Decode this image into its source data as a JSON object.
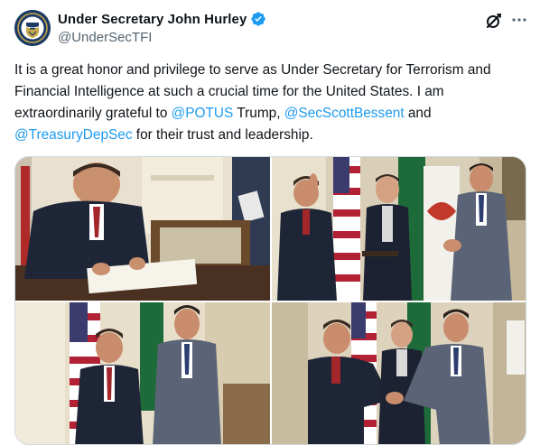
{
  "author": {
    "display_name": "Under Secretary John Hurley",
    "handle": "@UnderSecTFI",
    "verified": true,
    "avatar_icon": "treasury-seal-icon"
  },
  "actions": {
    "grok_icon": "grok-icon",
    "more_icon": "more-horizontal-icon",
    "more_glyph": "···"
  },
  "tweet": {
    "text_part1": "It is a great honor and privilege to serve as Under Secretary for Terrorism and Financial Intelligence at such a crucial time for the United States.  I am extraordinarily grateful to ",
    "mention1": "@POTUS",
    "text_part2": " Trump, ",
    "mention2": "@SecScottBessent",
    "text_part3": " and ",
    "mention3": "@TreasuryDepSec",
    "text_part4": " for their trust and leadership."
  },
  "colors": {
    "link": "#1d9bf0",
    "verified": "#1d9bf0",
    "secondary_text": "#536471",
    "border": "#cfd9de"
  }
}
